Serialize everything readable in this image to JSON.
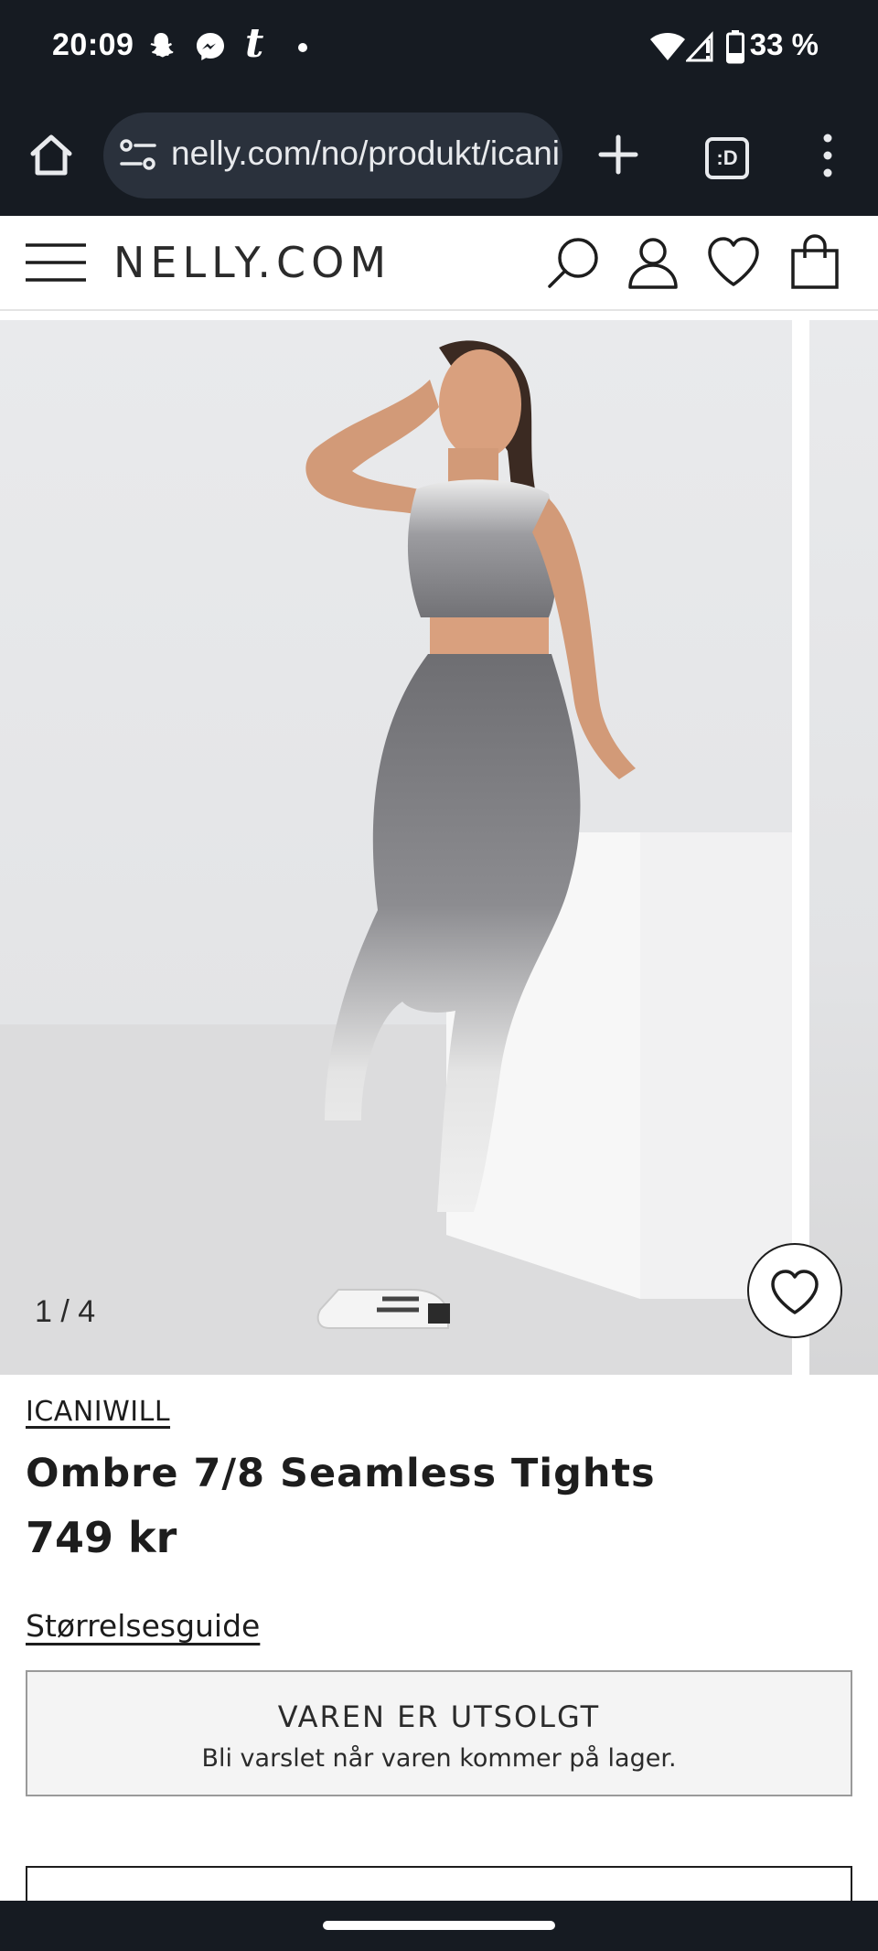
{
  "status_bar": {
    "time": "20:09",
    "battery": "33 %",
    "notification_icons": [
      "snapchat-icon",
      "messenger-icon",
      "tumblr-icon",
      "dot-icon"
    ],
    "system_icons": [
      "wifi-icon",
      "signal-icon",
      "battery-icon"
    ]
  },
  "browser": {
    "url": "nelly.com/no/produkt/icaniwill",
    "tabs_label": ":D"
  },
  "site_header": {
    "logo": "NELLY.COM",
    "icons": [
      "menu-icon",
      "search-icon",
      "account-icon",
      "wishlist-icon",
      "bag-icon"
    ]
  },
  "gallery": {
    "pager": "1 / 4"
  },
  "product": {
    "brand": "ICANIWILL",
    "name": "Ombre 7/8 Seamless Tights",
    "price": "749 kr",
    "size_guide": "Størrelsesguide"
  },
  "stock": {
    "title": "VAREN ER UTSOLGT",
    "subtitle": "Bli varslet når varen kommer på lager."
  },
  "colors": {
    "system_bar": "#161b22",
    "omnibox": "#2a313c",
    "text": "#1d1d1d"
  }
}
